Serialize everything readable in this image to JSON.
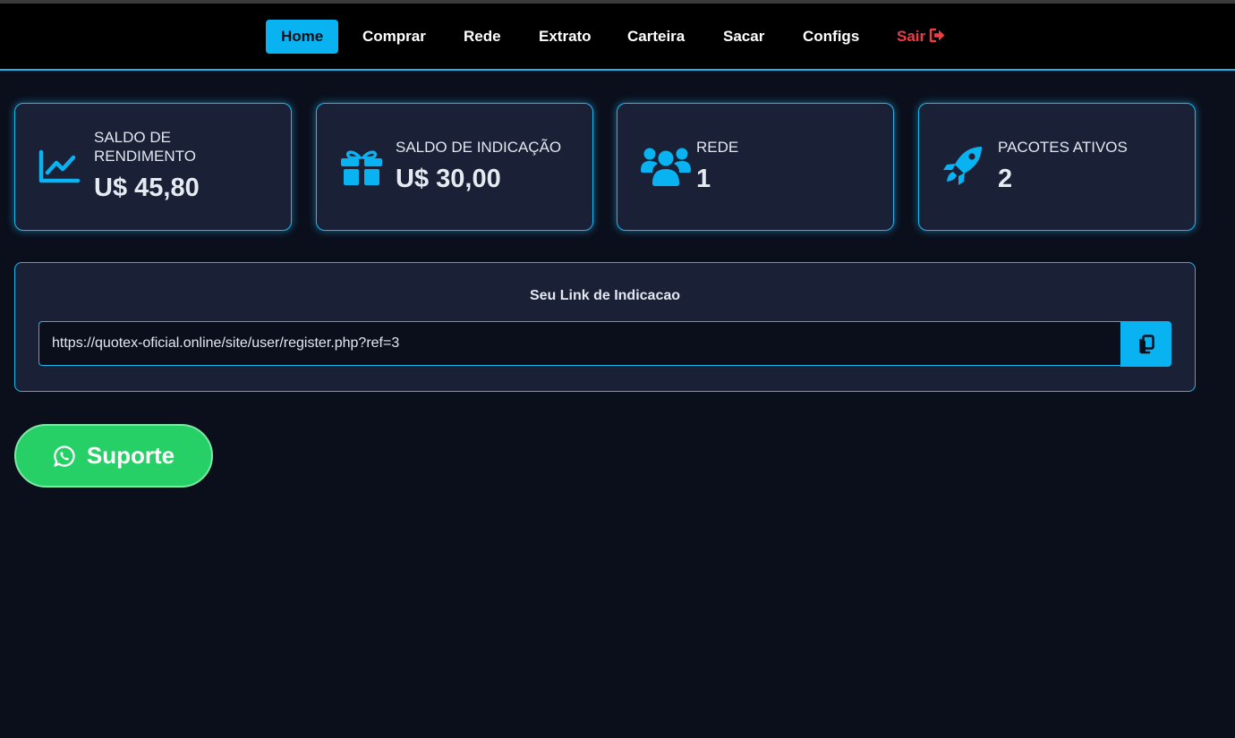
{
  "nav": {
    "items": [
      {
        "label": "Home",
        "active": true
      },
      {
        "label": "Comprar"
      },
      {
        "label": "Rede"
      },
      {
        "label": "Extrato"
      },
      {
        "label": "Carteira"
      },
      {
        "label": "Sacar"
      },
      {
        "label": "Configs"
      },
      {
        "label": "Sair",
        "icon": "sign-out-icon"
      }
    ]
  },
  "cards": [
    {
      "label": "Saldo de Rendimento",
      "value": "U$ 45,80",
      "icon": "chart-line-icon"
    },
    {
      "label": "Saldo de Indicação",
      "value": "U$ 30,00",
      "icon": "gift-icon"
    },
    {
      "label": "Rede",
      "value": "1",
      "icon": "users-icon"
    },
    {
      "label": "Pacotes Ativos",
      "value": "2",
      "icon": "rocket-icon"
    }
  ],
  "referral": {
    "title": "Seu Link de Indicacao",
    "link": "https://quotex-oficial.online/site/user/register.php?ref=3",
    "copy_icon": "copy-icon"
  },
  "support": {
    "label": "Suporte",
    "icon": "whatsapp-icon"
  },
  "colors": {
    "accent": "#09b3f2",
    "background": "#0b0f1c",
    "card": "#1a2035",
    "logout": "#ef3b43",
    "support": "#27d066"
  }
}
